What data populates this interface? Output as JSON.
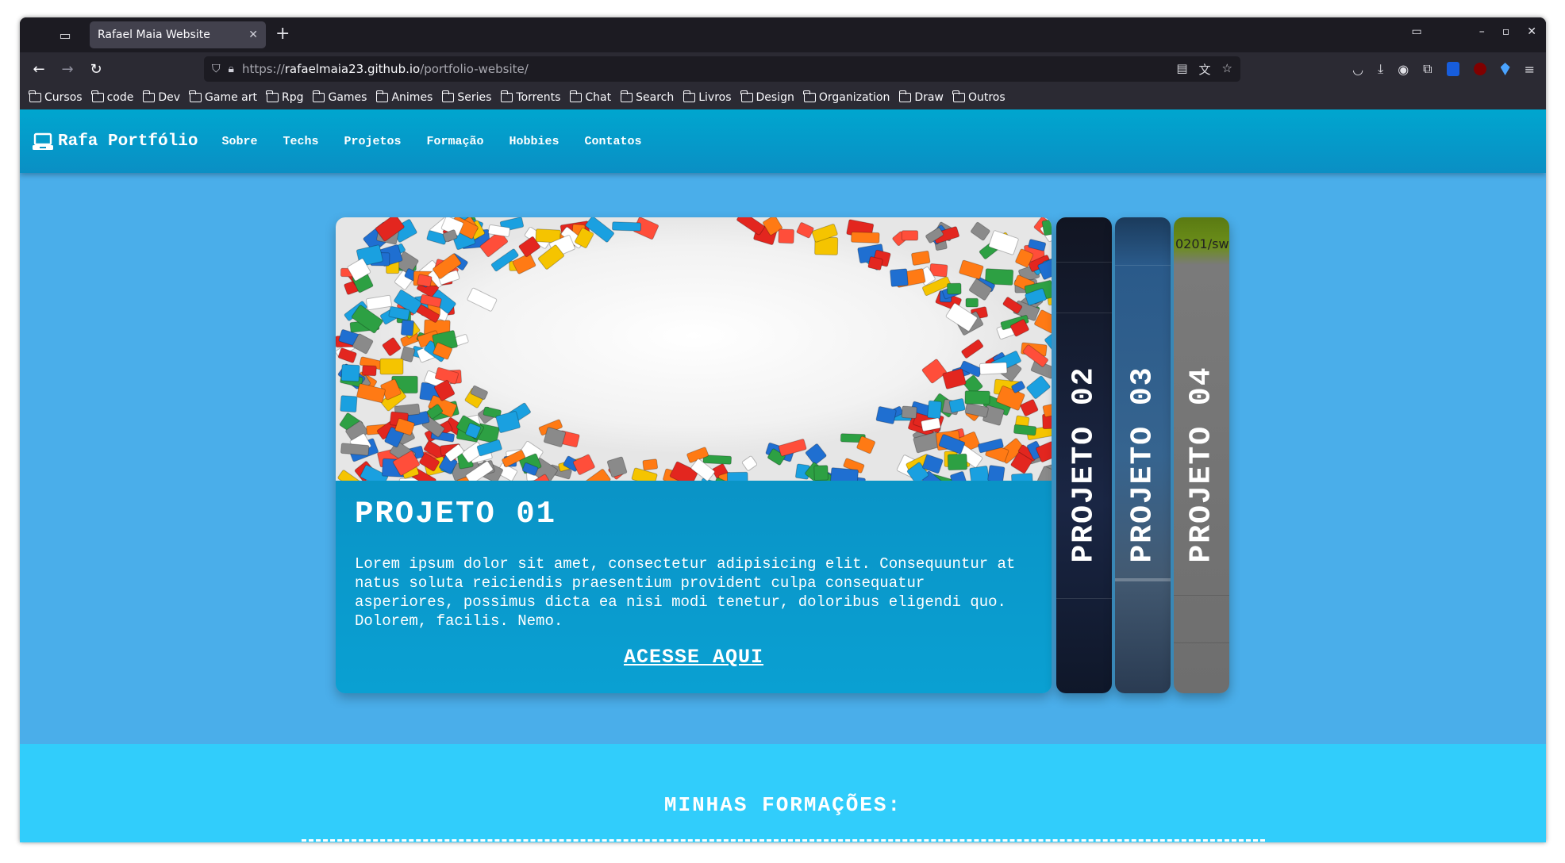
{
  "browser": {
    "tab_title": "Rafael Maia Website",
    "url_scheme": "https://",
    "url_host": "rafaelmaia23.github.io",
    "url_path": "/portfolio-website/",
    "bookmarks": [
      "Cursos",
      "code",
      "Dev",
      "Game art",
      "Rpg",
      "Games",
      "Animes",
      "Series",
      "Torrents",
      "Chat",
      "Search",
      "Livros",
      "Design",
      "Organization",
      "Draw",
      "Outros"
    ]
  },
  "site": {
    "logo_text": "Rafa Portfólio",
    "nav": [
      "Sobre",
      "Techs",
      "Projetos",
      "Formação",
      "Hobbies",
      "Contatos"
    ]
  },
  "projects": {
    "active": {
      "title": "PROJETO 01",
      "description": "Lorem ipsum dolor sit amet, consectetur adipisicing elit. Consequuntur at natus soluta reiciendis praesentium provident culpa consequatur asperiores, possimus dicta ea nisi modi tenetur, doloribus eligendi quo. Dolorem, facilis. Nemo.",
      "link_label": "ACESSE AQUI"
    },
    "others": [
      "PROJETO 02",
      "PROJETO 03",
      "PROJETO 04"
    ],
    "side4_snippet": "0201/sw"
  },
  "formacoes": {
    "heading": "MINHAS FORMAÇÕES:"
  },
  "colors": {
    "page_bg": "#4aaeea",
    "header_bg": "#0a98c8",
    "card_bg": "#0a94c6",
    "formacoes_bg": "#31cdfb"
  }
}
